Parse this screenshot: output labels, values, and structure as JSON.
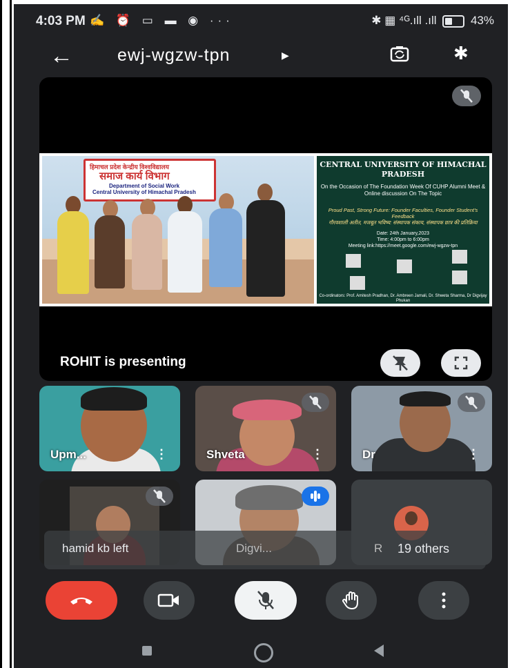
{
  "status_bar": {
    "time": "4:03 PM",
    "left_icons": "✍ ⏰ ▭ ▬ ◉ ···",
    "right_icons": "✱ ▦ ⁴ᴳ.ıll .ıll",
    "battery": "43%"
  },
  "header": {
    "meeting_code": "ewj-wgzw-tpn",
    "back_icon": "arrow-left-icon",
    "switch_camera_icon": "camera-switch-icon",
    "bluetooth_icon": "bluetooth-icon"
  },
  "presentation": {
    "label": "ROHIT is presenting",
    "banner_line1": "हिमाचल प्रदेश केन्द्रीय विश्वविद्यालय",
    "banner_line2": "समाज कार्य विभाग",
    "banner_line3": "Department of Social Work",
    "banner_line4": "Central University of Himachal Pradesh",
    "poster_title": "CENTRAL UNIVERSITY OF HIMACHAL PRADESH",
    "poster_sub": "On the Occasion of The Foundation Week Of CUHP Alumni Meet & Online discussion On The Topic",
    "poster_theme": "Proud Past, Strong Future: Founder Faculties, Founder Student's Feedback",
    "poster_theme_hi": "गौरवशाली अतीत, मजबूत भविष्य: संस्थापक संकाय, संस्थापक छात्र की प्रतिक्रिया",
    "poster_date": "Date: 24th January,2023",
    "poster_time": "Time: 4:00pm to 6:00pm",
    "poster_link": "Meeting link:https://meet.google.com/ewj-wgzw-tpn",
    "poster_coordinators": "Co-ordinators: Prof. Amitesh Pradhan, Dr. Ambreen Jamali, Dr. Shweta Sharma, Dr Digvijay Phukan"
  },
  "participants": [
    {
      "name": "Upm...",
      "muted": false
    },
    {
      "name": "Shveta",
      "muted": true
    },
    {
      "name": "Dr",
      "muted": true
    },
    {
      "name": "hamid kb left",
      "muted": true
    },
    {
      "name": "Digvi...",
      "muted": false,
      "speaking": true
    },
    {
      "name": "19 others",
      "muted": false
    }
  ],
  "overlay_names": {
    "n1": "hamid kb left",
    "n2": "Digvi...",
    "n3": "R",
    "n4": "19 others"
  },
  "colors": {
    "end_call": "#ea4335",
    "background": "#202124",
    "tile": "#3c4043",
    "speaking": "#1a73e8"
  }
}
